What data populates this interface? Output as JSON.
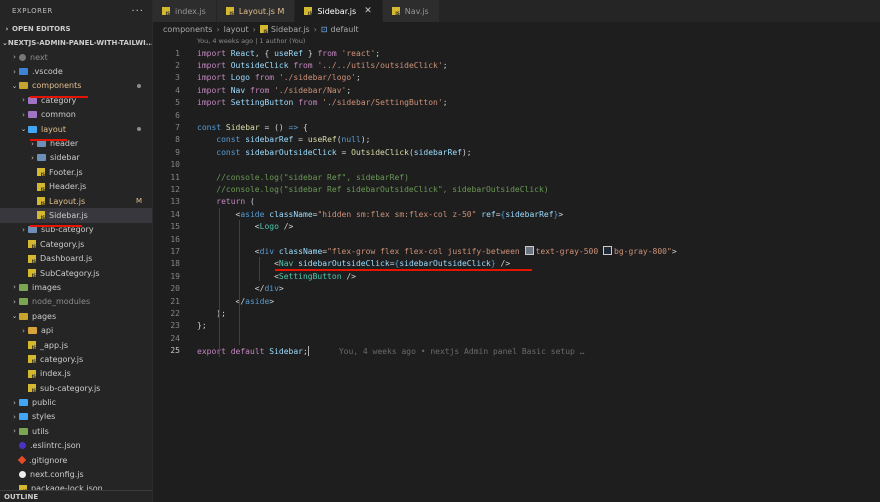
{
  "explorer": {
    "title": "EXPLORER",
    "more": "···",
    "open_editors": "OPEN EDITORS",
    "project": "NEXTJS-ADMIN-PANEL-WITH-TAILWI...",
    "outline": "OUTLINE",
    "tree": [
      {
        "label": "next",
        "prefix": ".",
        "kind": "folder-next",
        "depth": 0,
        "chev": "›",
        "dim": true
      },
      {
        "label": ".vscode",
        "kind": "folder-vscode",
        "depth": 0,
        "chev": "›"
      },
      {
        "label": "components",
        "kind": "folder-comp",
        "depth": 0,
        "chev": "⌄",
        "mod": true,
        "dot": true
      },
      {
        "label": "category",
        "kind": "folder-purple",
        "depth": 1,
        "chev": "›"
      },
      {
        "label": "common",
        "kind": "folder-purple",
        "depth": 1,
        "chev": "›"
      },
      {
        "label": "layout",
        "kind": "folder-lightblue",
        "depth": 1,
        "chev": "⌄",
        "mod": true,
        "dot": true
      },
      {
        "label": "header",
        "kind": "folder",
        "depth": 2,
        "chev": "›"
      },
      {
        "label": "sidebar",
        "kind": "folder",
        "depth": 2,
        "chev": "›"
      },
      {
        "label": "Footer.js",
        "kind": "js",
        "depth": 2
      },
      {
        "label": "Header.js",
        "kind": "js",
        "depth": 2
      },
      {
        "label": "Layout.js",
        "kind": "js",
        "depth": 2,
        "mod": true,
        "badge": "M"
      },
      {
        "label": "Sidebar.js",
        "kind": "js",
        "depth": 2,
        "selected": true
      },
      {
        "label": "sub-category",
        "kind": "folder",
        "depth": 1,
        "chev": "›"
      },
      {
        "label": "Category.js",
        "kind": "js",
        "depth": 1
      },
      {
        "label": "Dashboard.js",
        "kind": "js",
        "depth": 1
      },
      {
        "label": "SubCategory.js",
        "kind": "js",
        "depth": 1
      },
      {
        "label": "images",
        "kind": "folder-green",
        "depth": 0,
        "chev": "›"
      },
      {
        "label": "node_modules",
        "kind": "folder-green",
        "depth": 0,
        "chev": "›",
        "dim": true
      },
      {
        "label": "pages",
        "kind": "folder-comp",
        "depth": 0,
        "chev": "⌄"
      },
      {
        "label": "api",
        "kind": "folder-api",
        "depth": 1,
        "chev": "›"
      },
      {
        "label": "_app.js",
        "kind": "js",
        "depth": 1
      },
      {
        "label": "category.js",
        "kind": "js",
        "depth": 1
      },
      {
        "label": "index.js",
        "kind": "js",
        "depth": 1
      },
      {
        "label": "sub-category.js",
        "kind": "js",
        "depth": 1
      },
      {
        "label": "public",
        "kind": "folder-lightblue",
        "depth": 0,
        "chev": "›"
      },
      {
        "label": "styles",
        "kind": "folder-lightblue",
        "depth": 0,
        "chev": "›"
      },
      {
        "label": "utils",
        "kind": "folder-green",
        "depth": 0,
        "chev": "›"
      },
      {
        "label": ".eslintrc.json",
        "kind": "eslint",
        "depth": 0
      },
      {
        "label": ".gitignore",
        "kind": "git",
        "depth": 0
      },
      {
        "label": "next.config.js",
        "kind": "next",
        "depth": 0
      },
      {
        "label": "package-lock.json",
        "kind": "js",
        "depth": 0
      }
    ]
  },
  "tabs": [
    {
      "label": "index.js"
    },
    {
      "label": "Layout.js M",
      "mod": true
    },
    {
      "label": "Sidebar.js",
      "active": true,
      "close": "✕"
    },
    {
      "label": "Nav.js"
    }
  ],
  "breadcrumb": [
    "components",
    "layout",
    "Sidebar.js",
    "default"
  ],
  "blame_header": "You, 4 weeks ago | 1 author (You)",
  "inline_blame": "You, 4 weeks ago • nextjs Admin panel Basic setup …",
  "colors": {
    "accent": "#007acc",
    "underline": "#e51400"
  }
}
